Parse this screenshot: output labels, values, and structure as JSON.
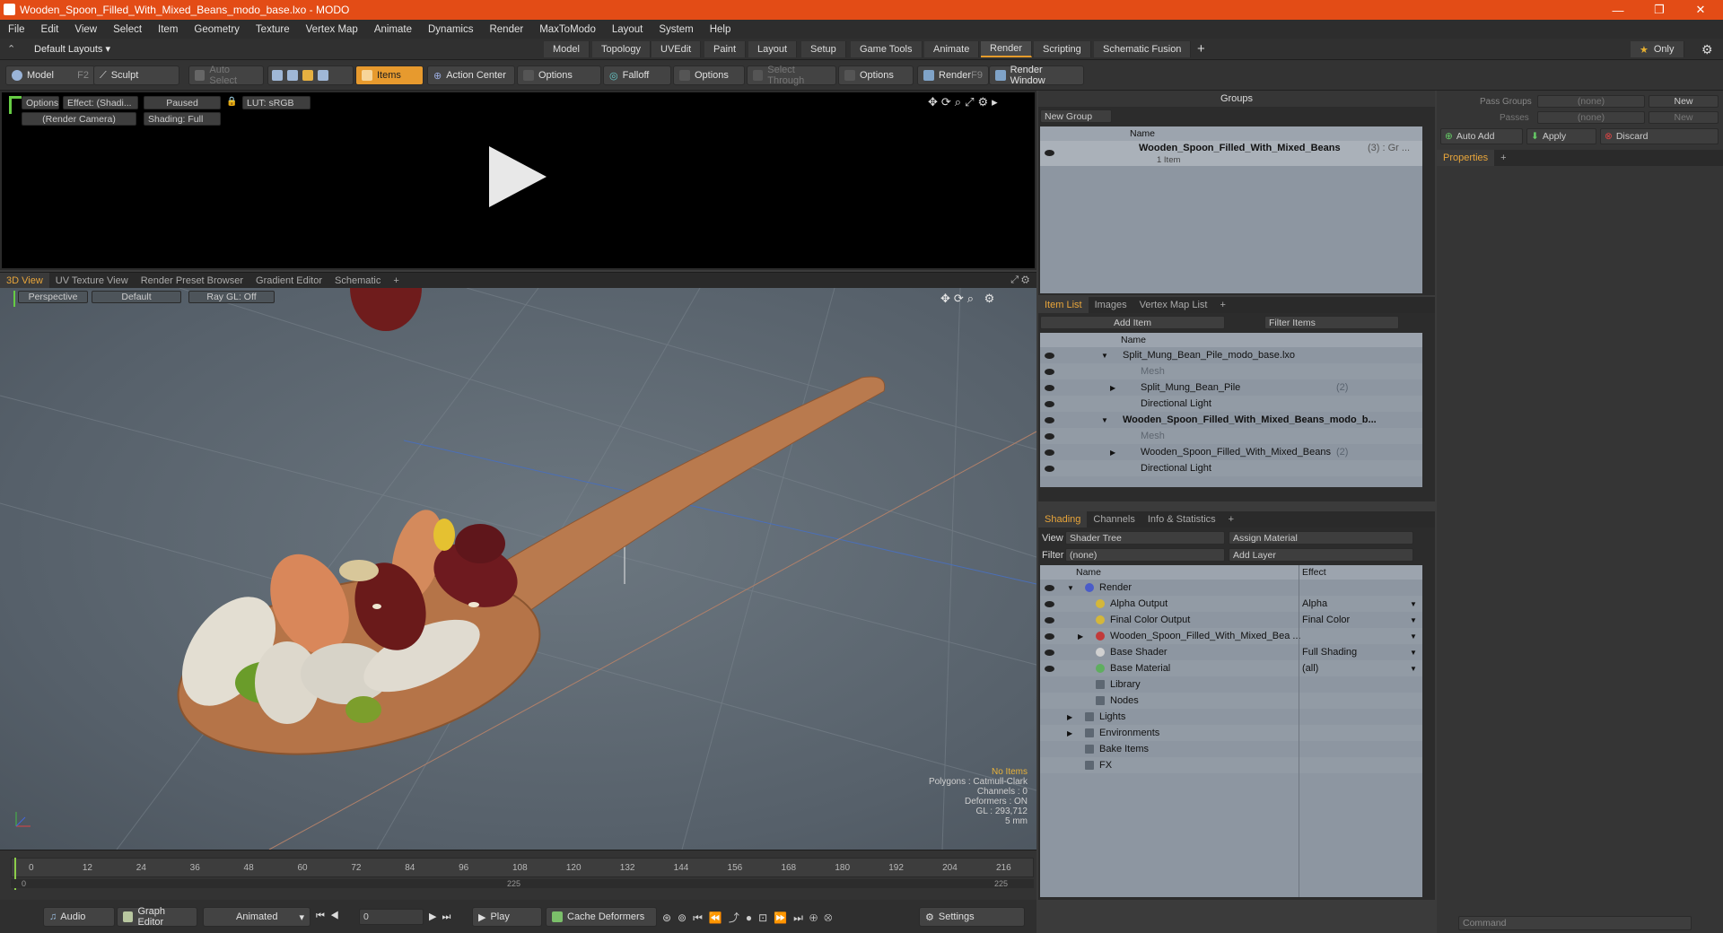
{
  "window": {
    "title": "Wooden_Spoon_Filled_With_Mixed_Beans_modo_base.lxo - MODO"
  },
  "menu": [
    "File",
    "Edit",
    "View",
    "Select",
    "Item",
    "Geometry",
    "Texture",
    "Vertex Map",
    "Animate",
    "Dynamics",
    "Render",
    "MaxToModo",
    "Layout",
    "System",
    "Help"
  ],
  "layout": {
    "preset": "Default Layouts",
    "tabs": [
      "Model",
      "Topology",
      "UVEdit",
      "Paint",
      "Layout",
      "Setup",
      "Game Tools",
      "Animate",
      "Render",
      "Scripting",
      "Schematic Fusion"
    ],
    "active_tab": "Render",
    "only_label": "Only"
  },
  "toolbar": {
    "model": "Model",
    "model_key": "F2",
    "sculpt": "Sculpt",
    "auto_select": "Auto Select",
    "items": "Items",
    "action_center": "Action Center",
    "options1": "Options",
    "falloff": "Falloff",
    "options2": "Options",
    "select_through": "Select Through",
    "options3": "Options",
    "render": "Render",
    "render_key": "F9",
    "render_window": "Render Window"
  },
  "render_view": {
    "options": "Options",
    "effect": "Effect: (Shadi...",
    "paused": "Paused",
    "lut": "LUT: sRGB",
    "camera": "(Render Camera)",
    "shading": "Shading: Full"
  },
  "viewport_tabs": [
    "3D View",
    "UV Texture View",
    "Render Preset Browser",
    "Gradient Editor",
    "Schematic"
  ],
  "viewport": {
    "perspective": "Perspective",
    "default": "Default",
    "raygl": "Ray GL: Off",
    "status": {
      "no_items": "No Items",
      "polygons": "Polygons : Catmull-Clark",
      "channels": "Channels : 0",
      "deformers": "Deformers : ON",
      "gl": "GL : 293,712",
      "scale": "5 mm"
    }
  },
  "groups": {
    "header": "Groups",
    "new_group": "New Group",
    "col_name": "Name",
    "item_name": "Wooden_Spoon_Filled_With_Mixed_Beans",
    "item_suffix": "(3) : Gr ...",
    "item_sub": "1 Item"
  },
  "item_list": {
    "tabs": [
      "Item List",
      "Images",
      "Vertex Map List"
    ],
    "add_item": "Add Item",
    "filter": "Filter Items",
    "col_name": "Name",
    "rows": [
      {
        "label": "Split_Mung_Bean_Pile_modo_base.lxo",
        "level": 0,
        "bold": false,
        "dim": false,
        "expander": "▼"
      },
      {
        "label": "Mesh",
        "level": 1,
        "bold": false,
        "dim": true,
        "expander": ""
      },
      {
        "label": "Split_Mung_Bean_Pile",
        "level": 1,
        "bold": false,
        "dim": false,
        "expander": "▶",
        "suffix": "(2)"
      },
      {
        "label": "Directional Light",
        "level": 1,
        "bold": false,
        "dim": false,
        "expander": ""
      },
      {
        "label": "Wooden_Spoon_Filled_With_Mixed_Beans_modo_b...",
        "level": 0,
        "bold": true,
        "dim": false,
        "expander": "▼"
      },
      {
        "label": "Mesh",
        "level": 1,
        "bold": false,
        "dim": true,
        "expander": ""
      },
      {
        "label": "Wooden_Spoon_Filled_With_Mixed_Beans",
        "level": 1,
        "bold": false,
        "dim": false,
        "expander": "▶",
        "suffix": "(2)"
      },
      {
        "label": "Directional Light",
        "level": 1,
        "bold": false,
        "dim": false,
        "expander": ""
      }
    ]
  },
  "shading": {
    "tabs": [
      "Shading",
      "Channels",
      "Info & Statistics"
    ],
    "view_label": "View",
    "view_value": "Shader Tree",
    "assign_material": "Assign Material",
    "filter_label": "Filter",
    "filter_value": "(none)",
    "add_layer": "Add Layer",
    "col_name": "Name",
    "col_effect": "Effect",
    "rows": [
      {
        "label": "Render",
        "effect": "",
        "level": 0,
        "expander": "▼",
        "icon": "#4a5cc9"
      },
      {
        "label": "Alpha Output",
        "effect": "Alpha",
        "level": 1,
        "expander": "",
        "icon": "#d4b73a"
      },
      {
        "label": "Final Color Output",
        "effect": "Final Color",
        "level": 1,
        "expander": "",
        "icon": "#d4b73a"
      },
      {
        "label": "Wooden_Spoon_Filled_With_Mixed_Bea ...",
        "effect": "",
        "level": 1,
        "expander": "▶",
        "icon": "#c23a3a"
      },
      {
        "label": "Base Shader",
        "effect": "Full Shading",
        "level": 1,
        "expander": "",
        "icon": "#d0d0d0"
      },
      {
        "label": "Base Material",
        "effect": "(all)",
        "level": 1,
        "expander": "",
        "icon": "#5fae5f"
      },
      {
        "label": "Library",
        "effect": "",
        "level": 1,
        "expander": "",
        "icon": ""
      },
      {
        "label": "Nodes",
        "effect": "",
        "level": 1,
        "expander": "",
        "icon": ""
      },
      {
        "label": "Lights",
        "effect": "",
        "level": 0,
        "expander": "▶",
        "icon": ""
      },
      {
        "label": "Environments",
        "effect": "",
        "level": 0,
        "expander": "▶",
        "icon": ""
      },
      {
        "label": "Bake Items",
        "effect": "",
        "level": 0,
        "expander": "",
        "icon": ""
      },
      {
        "label": "FX",
        "effect": "",
        "level": 0,
        "expander": "",
        "icon": ""
      }
    ]
  },
  "passes": {
    "pass_groups": "Pass Groups",
    "passes": "Passes",
    "none1": "(none)",
    "none2": "(none)",
    "new1": "New",
    "new2": "New",
    "auto_add": "Auto Add",
    "apply": "Apply",
    "discard": "Discard",
    "properties": "Properties"
  },
  "timeline": {
    "ticks": [
      "0",
      "12",
      "24",
      "36",
      "48",
      "60",
      "72",
      "84",
      "96",
      "108",
      "120",
      "132",
      "144",
      "156",
      "168",
      "180",
      "192",
      "204",
      "216"
    ],
    "start": "0",
    "end": "225",
    "mid": "225"
  },
  "bottom": {
    "audio": "Audio",
    "graph_editor": "Graph Editor",
    "animated": "Animated",
    "frame": "0",
    "play": "Play",
    "cache_deformers": "Cache Deformers",
    "settings": "Settings",
    "command": "Command"
  }
}
